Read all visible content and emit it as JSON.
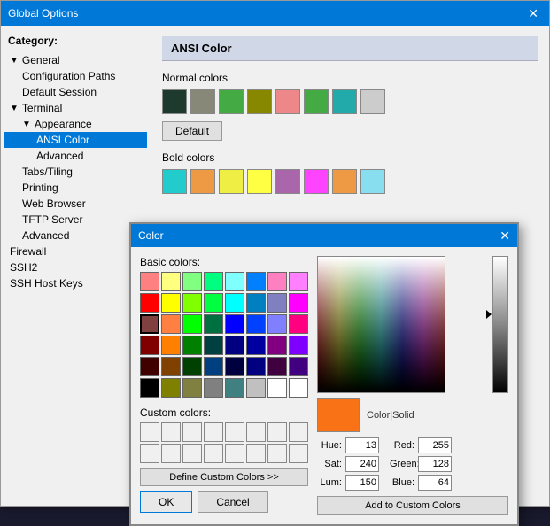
{
  "mainWindow": {
    "title": "Global Options",
    "closeLabel": "✕"
  },
  "sidebar": {
    "categoryLabel": "Category:",
    "items": [
      {
        "id": "general",
        "label": "General",
        "level": "root",
        "toggle": "▼"
      },
      {
        "id": "config-paths",
        "label": "Configuration Paths",
        "level": "child"
      },
      {
        "id": "default-session",
        "label": "Default Session",
        "level": "child"
      },
      {
        "id": "terminal",
        "label": "Terminal",
        "level": "root",
        "toggle": "▼"
      },
      {
        "id": "appearance",
        "label": "Appearance",
        "level": "child",
        "toggle": "▼"
      },
      {
        "id": "ansi-color",
        "label": "ANSI Color",
        "level": "grandchild",
        "selected": true
      },
      {
        "id": "advanced-appearance",
        "label": "Advanced",
        "level": "grandchild"
      },
      {
        "id": "tabs-tiling",
        "label": "Tabs/Tiling",
        "level": "child"
      },
      {
        "id": "printing",
        "label": "Printing",
        "level": "child"
      },
      {
        "id": "web-browser",
        "label": "Web Browser",
        "level": "child"
      },
      {
        "id": "tftp-server",
        "label": "TFTP Server",
        "level": "child"
      },
      {
        "id": "advanced-terminal",
        "label": "Advanced",
        "level": "child"
      },
      {
        "id": "firewall",
        "label": "Firewall",
        "level": "root"
      },
      {
        "id": "ssh2",
        "label": "SSH2",
        "level": "root"
      },
      {
        "id": "ssh-host-keys",
        "label": "SSH Host Keys",
        "level": "root"
      }
    ]
  },
  "rightPanel": {
    "title": "ANSI Color",
    "normalColorsLabel": "Normal colors",
    "boldColorsLabel": "Bold colors",
    "defaultButtonLabel": "Default",
    "normalColors": [
      "#1e3a2f",
      "#888878",
      "#44aa44",
      "#888800",
      "#ee8888",
      "#44aa44",
      "#22aaaa",
      "#cccccc"
    ],
    "boldColors": [
      "#22cccc",
      "#ee9944",
      "#eeee44",
      "#ffff44",
      "#aa66aa",
      "#ff44ff",
      "#ee9944",
      "#88ddee"
    ]
  },
  "colorDialog": {
    "title": "Color",
    "closeLabel": "✕",
    "basicColorsLabel": "Basic colors:",
    "customColorsLabel": "Custom colors:",
    "defineCustomLabel": "Define Custom Colors >>",
    "okLabel": "OK",
    "cancelLabel": "Cancel",
    "addCustomLabel": "Add to Custom Colors",
    "colorSolidLabel": "Color|Solid",
    "hueLabel": "Hue:",
    "satLabel": "Sat:",
    "lumLabel": "Lum:",
    "redLabel": "Red:",
    "greenLabel": "Green:",
    "blueLabel": "Blue:",
    "hueValue": "13",
    "satValue": "240",
    "lumValue": "150",
    "redValue": "255",
    "greenValue": "128",
    "blueValue": "64",
    "basicColors": [
      "#ff8080",
      "#ffff80",
      "#80ff80",
      "#00ff80",
      "#80ffff",
      "#0080ff",
      "#ff80c0",
      "#ff80ff",
      "#ff0000",
      "#ffff00",
      "#80ff00",
      "#00ff40",
      "#00ffff",
      "#0080c0",
      "#8080c0",
      "#ff00ff",
      "#804040",
      "#ff8040",
      "#00ff00",
      "#007040",
      "#0000ff",
      "#0040ff",
      "#8080ff",
      "#ff0080",
      "#800000",
      "#ff8000",
      "#008000",
      "#004040",
      "#000080",
      "#0000a0",
      "#800080",
      "#8000ff",
      "#400000",
      "#804000",
      "#004000",
      "#004080",
      "#000040",
      "#000080",
      "#400040",
      "#400080",
      "#000000",
      "#808000",
      "#808040",
      "#808080",
      "#408080",
      "#c0c0c0",
      "#ffffff",
      "#ffffff"
    ],
    "selectedSwatchIndex": 16
  }
}
